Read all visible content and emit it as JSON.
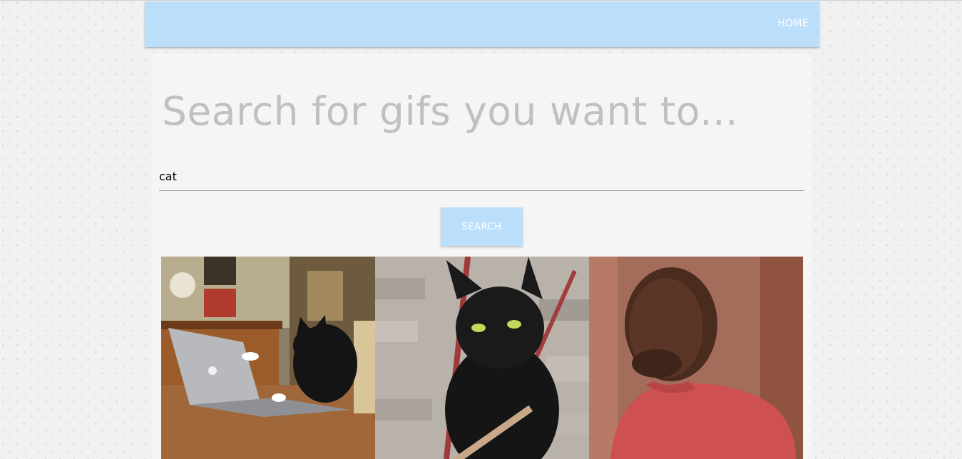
{
  "navbar": {
    "home_label": "HOME",
    "color": "#bbdefb"
  },
  "search": {
    "headline": "Search for gifs you want to...",
    "value": "cat",
    "button_label": "SEARCH"
  },
  "results": [
    {
      "id": "gif-cat-laptop"
    },
    {
      "id": "gif-cat-nail-file"
    },
    {
      "id": "gif-man-red-shirt"
    }
  ]
}
